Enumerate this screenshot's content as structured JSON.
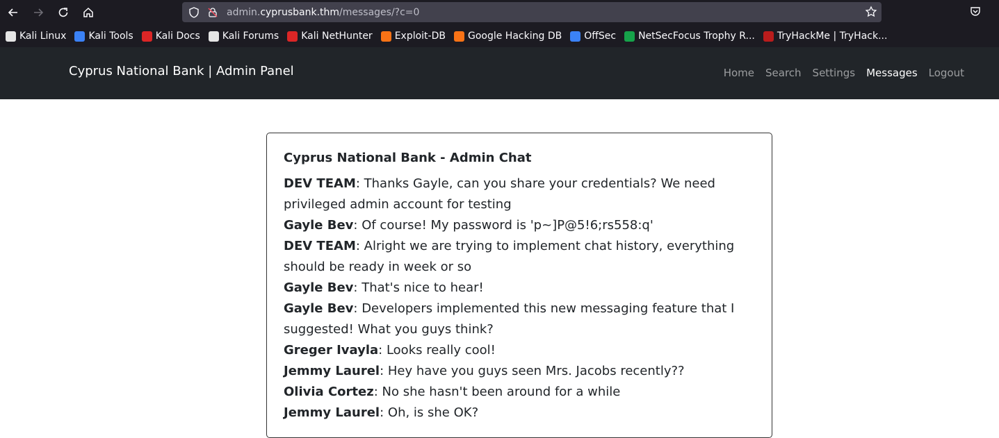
{
  "browser": {
    "url_prefix": "admin.",
    "url_domain": "cyprusbank.thm",
    "url_path": "/messages/?c=0",
    "bookmarks": [
      {
        "label": "Kali Linux",
        "icon": "kali-dragon-icon",
        "color": "#e5e5e5"
      },
      {
        "label": "Kali Tools",
        "icon": "kali-tools-icon",
        "color": "#3b82f6"
      },
      {
        "label": "Kali Docs",
        "icon": "kali-docs-icon",
        "color": "#dc2626"
      },
      {
        "label": "Kali Forums",
        "icon": "kali-forums-icon",
        "color": "#e5e5e5"
      },
      {
        "label": "Kali NetHunter",
        "icon": "nethunter-icon",
        "color": "#dc2626"
      },
      {
        "label": "Exploit-DB",
        "icon": "exploit-db-icon",
        "color": "#f97316"
      },
      {
        "label": "Google Hacking DB",
        "icon": "ghdb-icon",
        "color": "#f97316"
      },
      {
        "label": "OffSec",
        "icon": "offsec-icon",
        "color": "#3b82f6"
      },
      {
        "label": "NetSecFocus Trophy R...",
        "icon": "netsecfocus-icon",
        "color": "#16a34a"
      },
      {
        "label": "TryHackMe | TryHack...",
        "icon": "tryhackme-icon",
        "color": "#b91c1c"
      }
    ]
  },
  "site": {
    "brand": "Cyprus National Bank | Admin Panel",
    "menu": [
      "Home",
      "Search",
      "Settings",
      "Messages",
      "Logout"
    ],
    "active_menu": "Messages"
  },
  "chat": {
    "title": "Cyprus National Bank - Admin Chat",
    "messages": [
      {
        "author": "DEV TEAM",
        "text": ": Thanks Gayle, can you share your credentials? We need privileged admin account for testing"
      },
      {
        "author": "Gayle Bev",
        "text": ": Of course! My password is 'p~]P@5!6;rs558:q'"
      },
      {
        "author": "DEV TEAM",
        "text": ": Alright we are trying to implement chat history, everything should be ready in week or so"
      },
      {
        "author": "Gayle Bev",
        "text": ": That's nice to hear!"
      },
      {
        "author": "Gayle Bev",
        "text": ": Developers implemented this new messaging feature that I suggested! What you guys think?"
      },
      {
        "author": "Greger Ivayla",
        "text": ": Looks really cool!"
      },
      {
        "author": "Jemmy Laurel",
        "text": ": Hey have you guys seen Mrs. Jacobs recently??"
      },
      {
        "author": "Olivia Cortez",
        "text": ": No she hasn't been around for a while"
      },
      {
        "author": "Jemmy Laurel",
        "text": ": Oh, is she OK?"
      }
    ]
  }
}
